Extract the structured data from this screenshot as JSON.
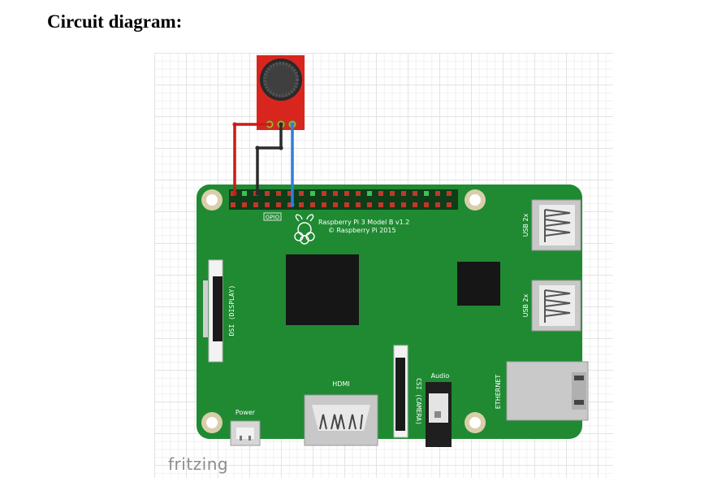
{
  "heading": "Circuit diagram:",
  "board": {
    "model_line": "Raspberry Pi 3 Model B v1.2",
    "copyright_line": "© Raspberry Pi 2015",
    "gpio_label": "GPIO",
    "usb_label_top": "USB 2x",
    "usb_label_bottom": "USB 2x",
    "ethernet_label": "ETHERNET",
    "display_label": "DSI (DISPLAY)",
    "camera_label": "CSI (CAMERA)",
    "hdmi_label": "HDMI",
    "audio_label": "Audio",
    "power_label": "Power"
  },
  "wires": [
    {
      "name": "red-wire",
      "color": "#cc1a1a"
    },
    {
      "name": "black-wire",
      "color": "#2b2b2b"
    },
    {
      "name": "blue-wire",
      "color": "#2f7ed8"
    }
  ],
  "colors": {
    "pcb": "#1f8a32",
    "sensor": "#d8261e",
    "chip": "#161616"
  },
  "logo_text": "fritzing"
}
